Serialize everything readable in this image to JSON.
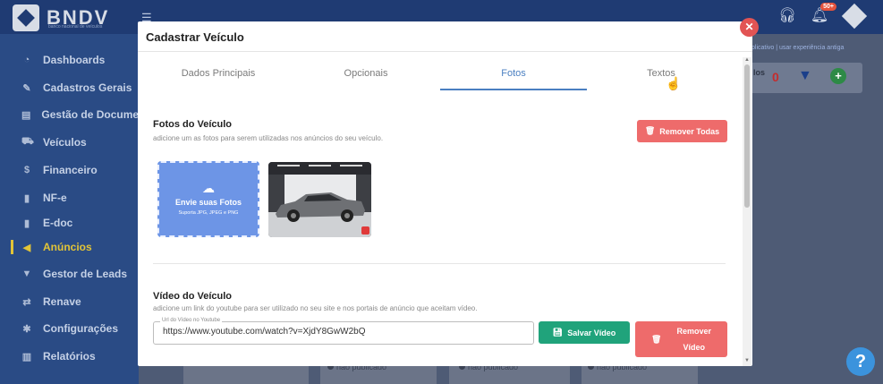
{
  "app": {
    "brand": "BNDV",
    "brand_subtitle": "banco nacional de veículos",
    "notification_count": "50+"
  },
  "sidebar": {
    "items": [
      {
        "label": "Dashboards",
        "icon": "dashboard-icon"
      },
      {
        "label": "Cadastros Gerais",
        "icon": "edit-icon"
      },
      {
        "label": "Gestão de Documentos",
        "icon": "folder-icon"
      },
      {
        "label": "Veículos",
        "icon": "car-icon"
      },
      {
        "label": "Financeiro",
        "icon": "dollar-icon"
      },
      {
        "label": "NF-e",
        "icon": "file-icon"
      },
      {
        "label": "E-doc",
        "icon": "file-icon"
      },
      {
        "label": "Anúncios",
        "icon": "megaphone-icon",
        "active": true
      },
      {
        "label": "Gestor de Leads",
        "icon": "filter-icon"
      },
      {
        "label": "Renave",
        "icon": "exchange-icon"
      },
      {
        "label": "Configurações",
        "icon": "gear-icon"
      },
      {
        "label": "Relatórios",
        "icon": "bar-chart-icon"
      }
    ]
  },
  "background": {
    "links": "plicativo | usar experiência antiga",
    "filters_label": "los",
    "filters_count": "0",
    "statuses": [
      "não publicado",
      "não publicado",
      "não publicado"
    ]
  },
  "modal": {
    "title": "Cadastrar Veículo",
    "tabs": [
      "Dados Principais",
      "Opcionais",
      "Fotos",
      "Textos"
    ],
    "active_tab": "Fotos",
    "photos": {
      "title": "Fotos do Veículo",
      "description": "adicione um as fotos para serem utilizadas nos anúncios do seu veículo.",
      "remove_all_label": "Remover Todas",
      "upload_title": "Envie suas Fotos",
      "upload_formats": "Suporta JPG, JPEG e PNG"
    },
    "video": {
      "title": "Vídeo do Veículo",
      "description": "adicione um link do youtube para ser utilizado no seu site e nos portais de anúncio que aceitam vídeo.",
      "url_label": "Url do Vídeo no Youtube",
      "url_value": "https://www.youtube.com/watch?v=XjdY8GwW2bQ",
      "save_label": "Salvar Vídeo",
      "remove_label_1": "Remover",
      "remove_label_2": "Vídeo"
    }
  },
  "colors": {
    "accent": "#4a7fc1",
    "danger": "#ee6b6b",
    "success": "#20a37b",
    "upload_box": "#6d95e6",
    "sidebar_active": "#e2c437"
  }
}
